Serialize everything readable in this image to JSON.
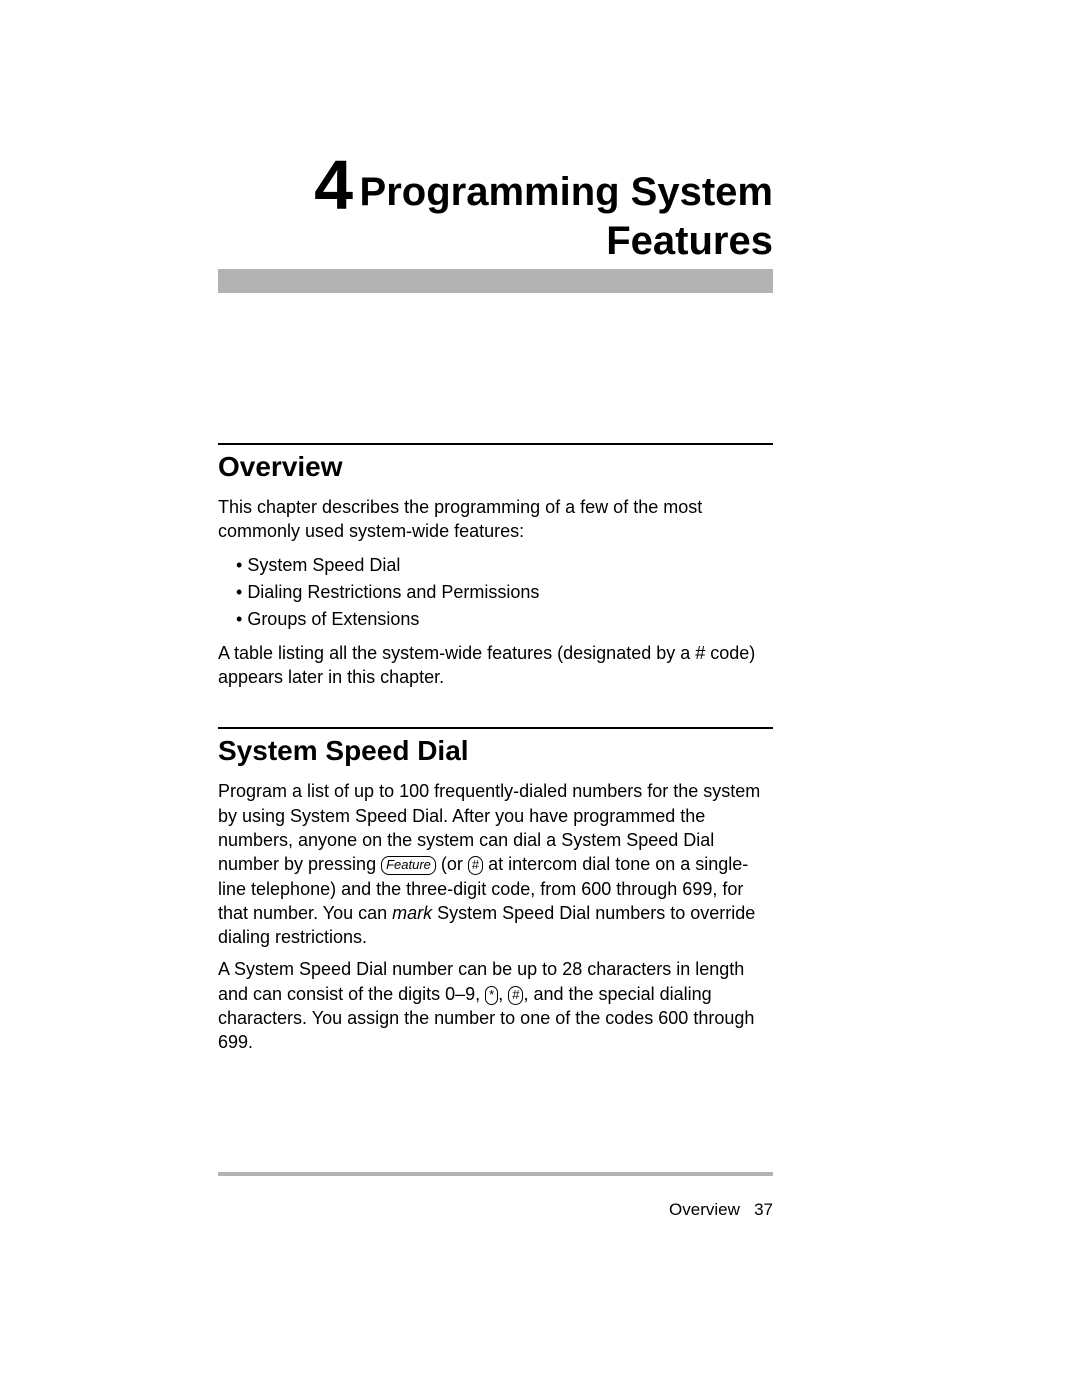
{
  "chapter": {
    "number": "4",
    "title_line1": "Programming System",
    "title_line2": "Features"
  },
  "sections": {
    "overview": {
      "heading": "Overview",
      "intro": "This chapter describes the programming of a few of the most commonly used system-wide features:",
      "bullets": [
        "System Speed Dial",
        "Dialing Restrictions and Permissions",
        "Groups of Extensions"
      ],
      "outro": "A table listing all the system-wide features (designated by a # code) appears later in this chapter."
    },
    "speed_dial": {
      "heading": "System Speed Dial",
      "p1a": "Program a list of up to 100 frequently-dialed numbers for the system by using System Speed Dial. After you have programmed the numbers, anyone on the system can dial a System Speed Dial number by pressing ",
      "key_feature": "Feature",
      "p1b": " (or ",
      "key_hash1": "#",
      "p1c": " at intercom dial tone on a single-line telephone) and the three-digit code, from 600 through 699, for that number. You can ",
      "p1_mark": "mark",
      "p1d": " System Speed Dial numbers to override dialing restrictions.",
      "p2a": "A System Speed Dial number can be up to 28 characters in length and can consist of the digits 0–9, ",
      "key_star": "*",
      "p2b": ", ",
      "key_hash2": "#",
      "p2c": ", and the special dialing characters. You assign the number to one of the codes 600 through 699."
    }
  },
  "footer": {
    "label": "Overview",
    "page": "37"
  }
}
